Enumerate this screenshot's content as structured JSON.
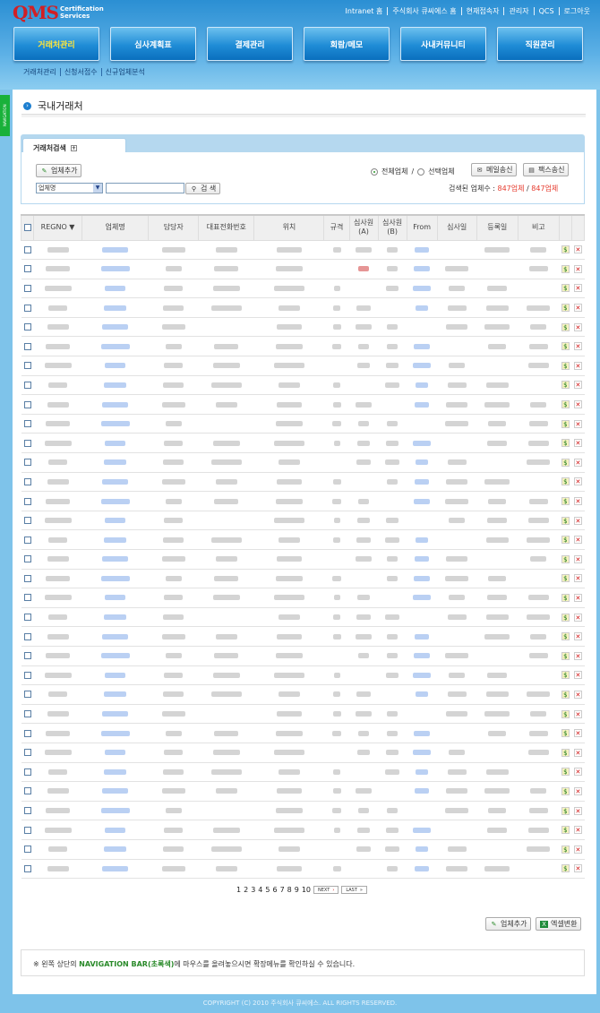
{
  "header": {
    "logo_mark": "QMS",
    "logo_sub1": "Certification",
    "logo_sub2": "Services",
    "links": [
      "Intranet 홈",
      "주식회사 큐씨에스 홈",
      "현재접속자",
      "관리자",
      "QCS",
      "로그아웃"
    ]
  },
  "nav": {
    "menus": [
      "거래처관리",
      "심사계획표",
      "결제관리",
      "회람/메모",
      "사내커뮤니티",
      "직원관리"
    ],
    "active": "거래처관리"
  },
  "subnav": [
    "거래처관리",
    "신청서접수",
    "신규업체분석"
  ],
  "navbar_tab": "NAVIGATION",
  "page_title": "국내거래처",
  "search": {
    "tab_label": "거래처검색",
    "add_button": "업체추가",
    "radio_all": "전체업체",
    "radio_sep": "/",
    "radio_selected": "선택업체",
    "mail_button": "메일송신",
    "fax_button": "팩스송신",
    "field_select": "업체명",
    "keyword": "",
    "search_button": "검 색",
    "count_label": "검색된 업체수 :",
    "count_a": "847업체",
    "count_sep": "/",
    "count_b": "847업체"
  },
  "table": {
    "headers": [
      "REGNO ▼",
      "업체명",
      "담당자",
      "대표전화번호",
      "위치",
      "규격",
      "심사원\n(A)",
      "심사원\n(B)",
      "From",
      "심사일",
      "등록일",
      "비고"
    ],
    "row_count": 33
  },
  "pager": {
    "pages": [
      "1",
      "2",
      "3",
      "4",
      "5",
      "6",
      "7",
      "8",
      "9",
      "10"
    ],
    "next": "NEXT",
    "last": "LAST"
  },
  "footer_buttons": {
    "add": "업체추가",
    "excel": "엑셀변환"
  },
  "notice": {
    "prefix": "※ 왼쪽 상단의",
    "highlight": "NAVIGATION BAR(초록색)",
    "suffix": "에 마우스를 올려놓으시면 확장메뉴를 확인하실 수 있습니다."
  },
  "copyright": "COPYRIGHT (C) 2010 주식회사 큐씨에스. ALL RIGHTS RESERVED."
}
